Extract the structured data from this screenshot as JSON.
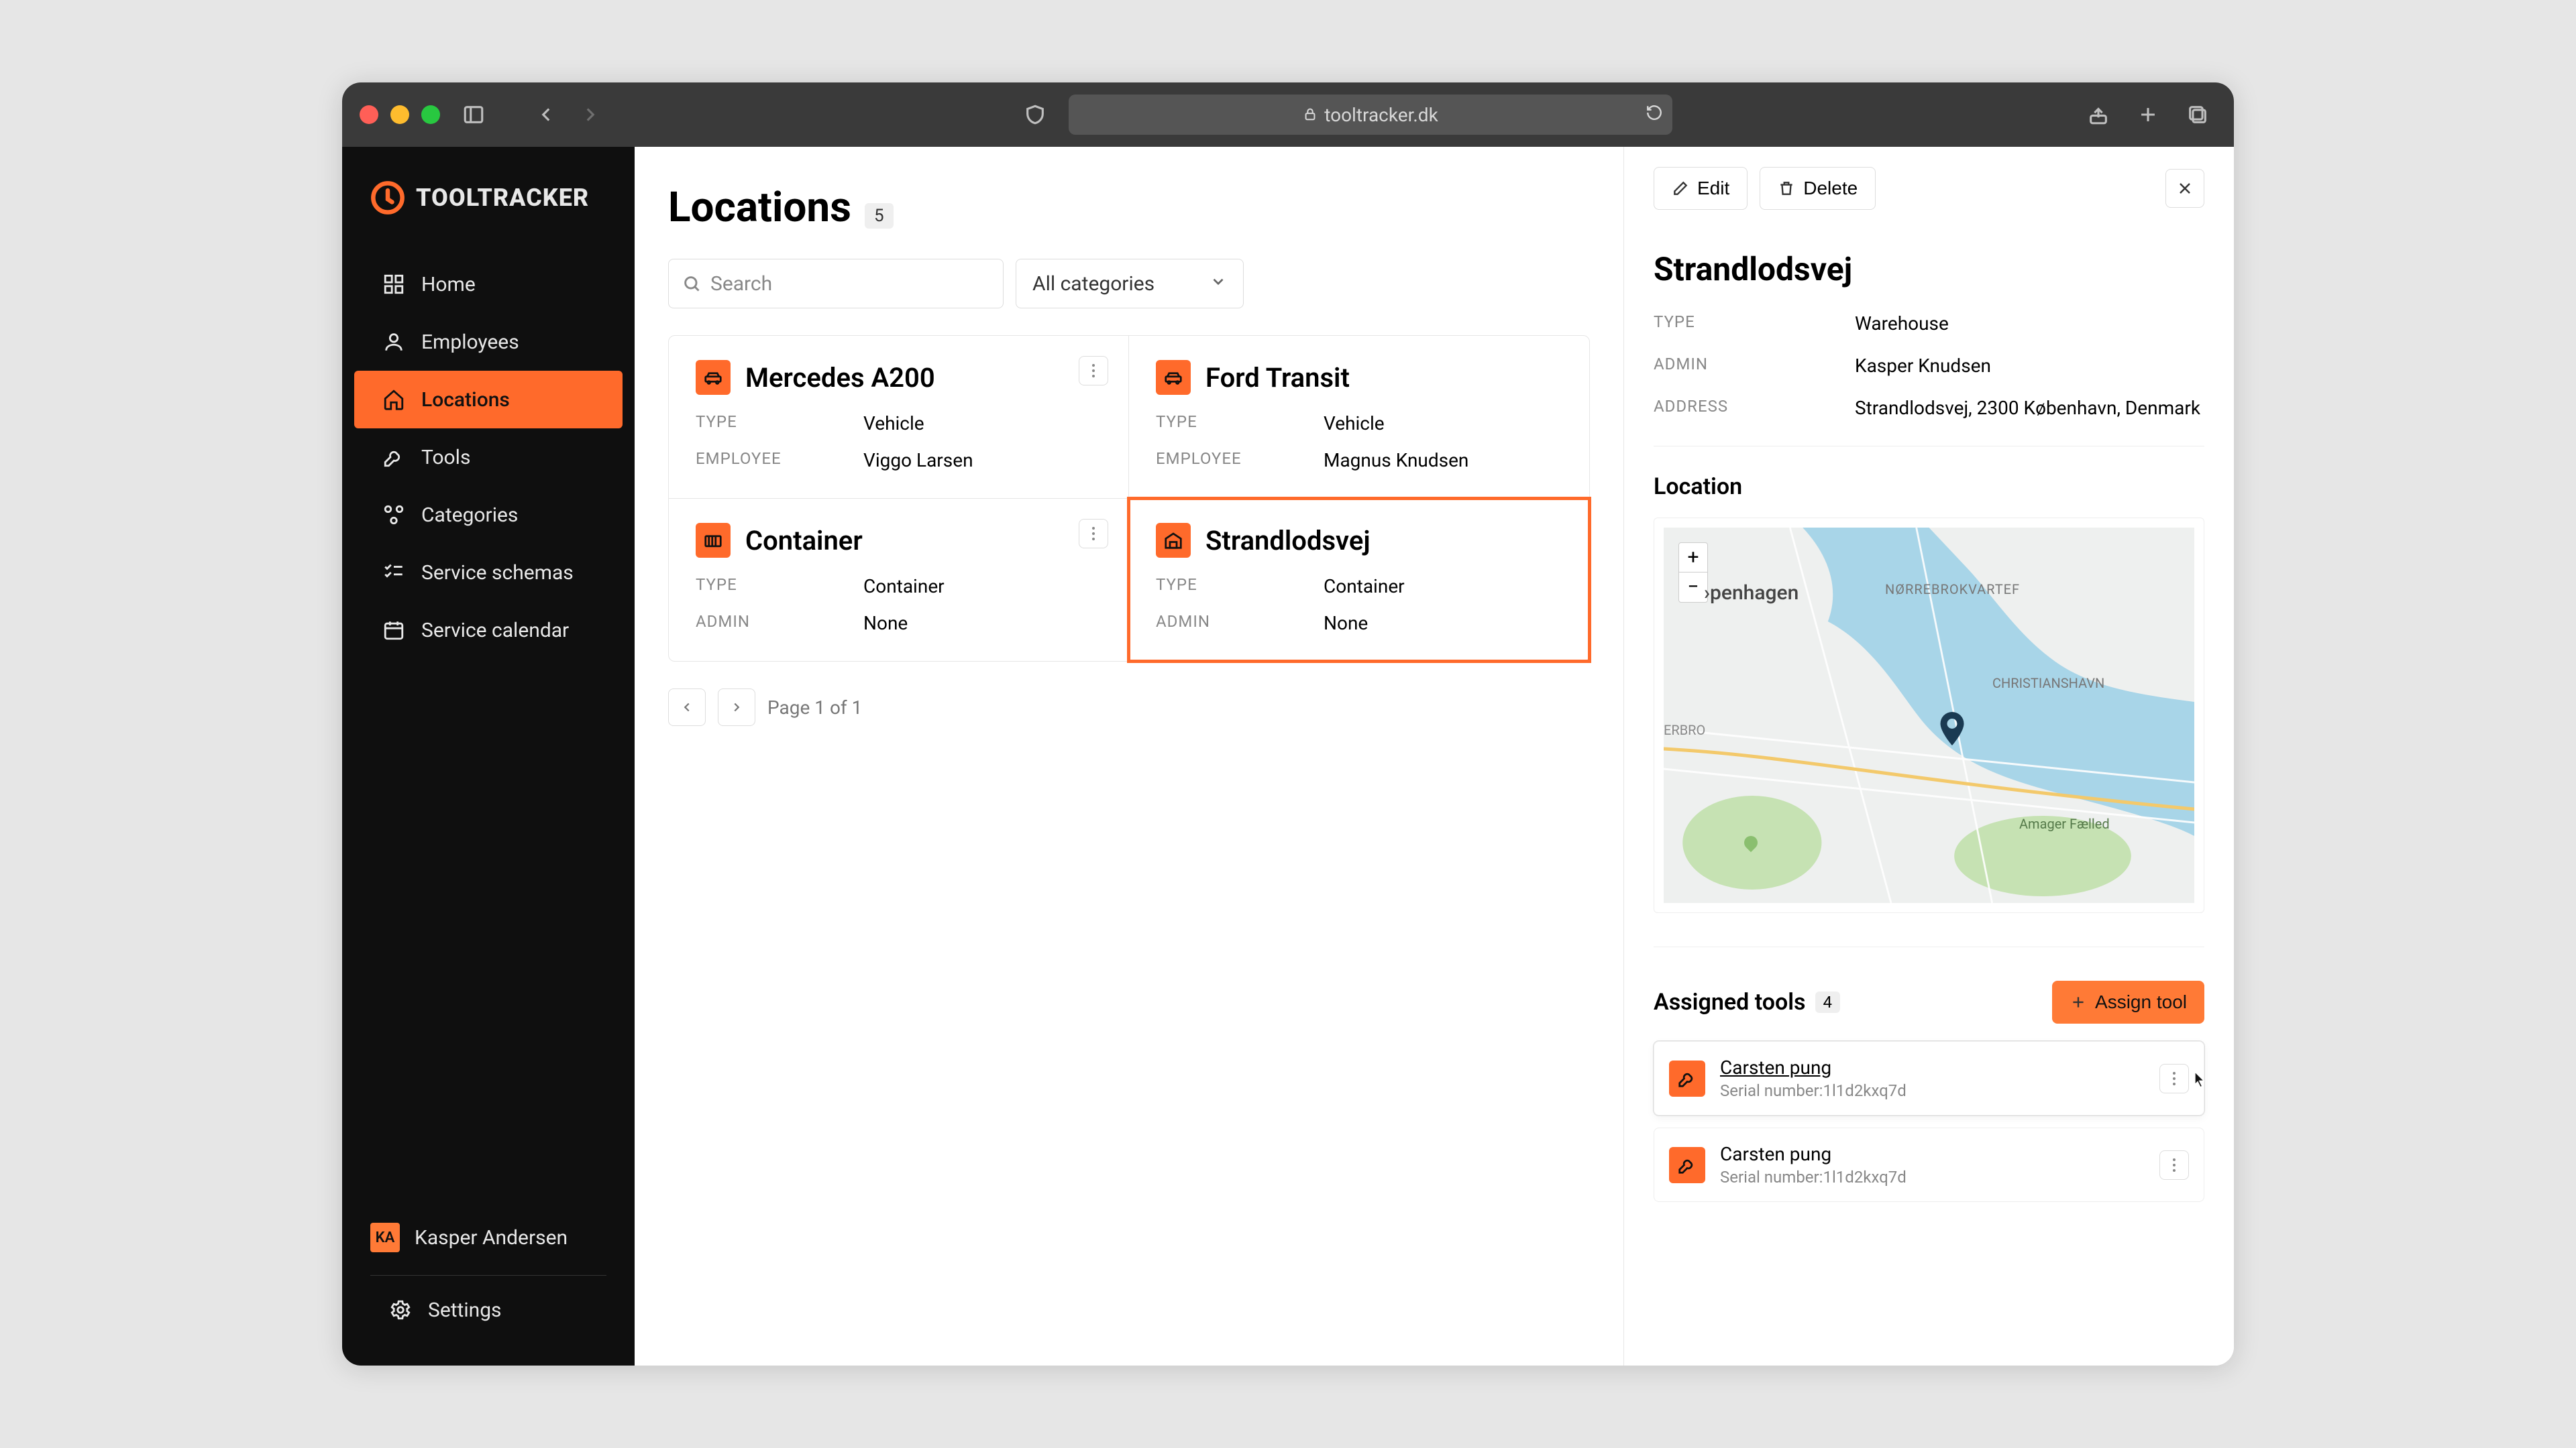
{
  "browser": {
    "url": "tooltracker.dk"
  },
  "brand": {
    "name": "TOOLTRACKER"
  },
  "sidebar": {
    "items": [
      {
        "id": "home",
        "label": "Home"
      },
      {
        "id": "employees",
        "label": "Employees"
      },
      {
        "id": "locations",
        "label": "Locations",
        "active": true
      },
      {
        "id": "tools",
        "label": "Tools"
      },
      {
        "id": "categories",
        "label": "Categories"
      },
      {
        "id": "service-schemas",
        "label": "Service schemas"
      },
      {
        "id": "service-calendar",
        "label": "Service calendar"
      }
    ],
    "user": {
      "initials": "KA",
      "name": "Kasper Andersen"
    },
    "settings_label": "Settings"
  },
  "page": {
    "title": "Locations",
    "count": "5",
    "search_placeholder": "Search",
    "category_filter": "All categories"
  },
  "locations": [
    {
      "id": "merc",
      "icon": "car",
      "name": "Mercedes A200",
      "type_label": "TYPE",
      "type": "Vehicle",
      "sub_label": "EMPLOYEE",
      "sub": "Viggo Larsen",
      "menu": true,
      "selected": false
    },
    {
      "id": "ford",
      "icon": "car",
      "name": "Ford Transit",
      "type_label": "TYPE",
      "type": "Vehicle",
      "sub_label": "EMPLOYEE",
      "sub": "Magnus Knudsen",
      "menu": false,
      "selected": false
    },
    {
      "id": "cont",
      "icon": "container",
      "name": "Container",
      "type_label": "TYPE",
      "type": "Container",
      "sub_label": "ADMIN",
      "sub": "None",
      "menu": true,
      "selected": false
    },
    {
      "id": "strand",
      "icon": "warehouse",
      "name": "Strandlodsvej",
      "type_label": "TYPE",
      "type": "Container",
      "sub_label": "ADMIN",
      "sub": "None",
      "menu": false,
      "selected": true
    }
  ],
  "pagination": {
    "label": "Page 1 of 1"
  },
  "detail": {
    "edit_label": "Edit",
    "delete_label": "Delete",
    "title": "Strandlodsvej",
    "fields": {
      "type_label": "TYPE",
      "type": "Warehouse",
      "admin_label": "ADMIN",
      "admin": "Kasper Knudsen",
      "address_label": "ADDRESS",
      "address": "Strandlodsvej, 2300 København, Denmark"
    },
    "location_section": "Location",
    "map_city": "›penhagen",
    "map_areas": [
      "NØRREBROKVARTEF",
      "CHRISTIANSHAVN",
      "ERBRO",
      "Amager Fælled"
    ],
    "tools_section": "Assigned tools",
    "tools_count": "4",
    "assign_label": "Assign tool",
    "tools": [
      {
        "name": "Carsten pung",
        "serial_label": "Serial number:",
        "serial": "1l1d2kxq7d",
        "hover": true
      },
      {
        "name": "Carsten pung",
        "serial_label": "Serial number:",
        "serial": "1l1d2kxq7d",
        "hover": false
      }
    ]
  }
}
